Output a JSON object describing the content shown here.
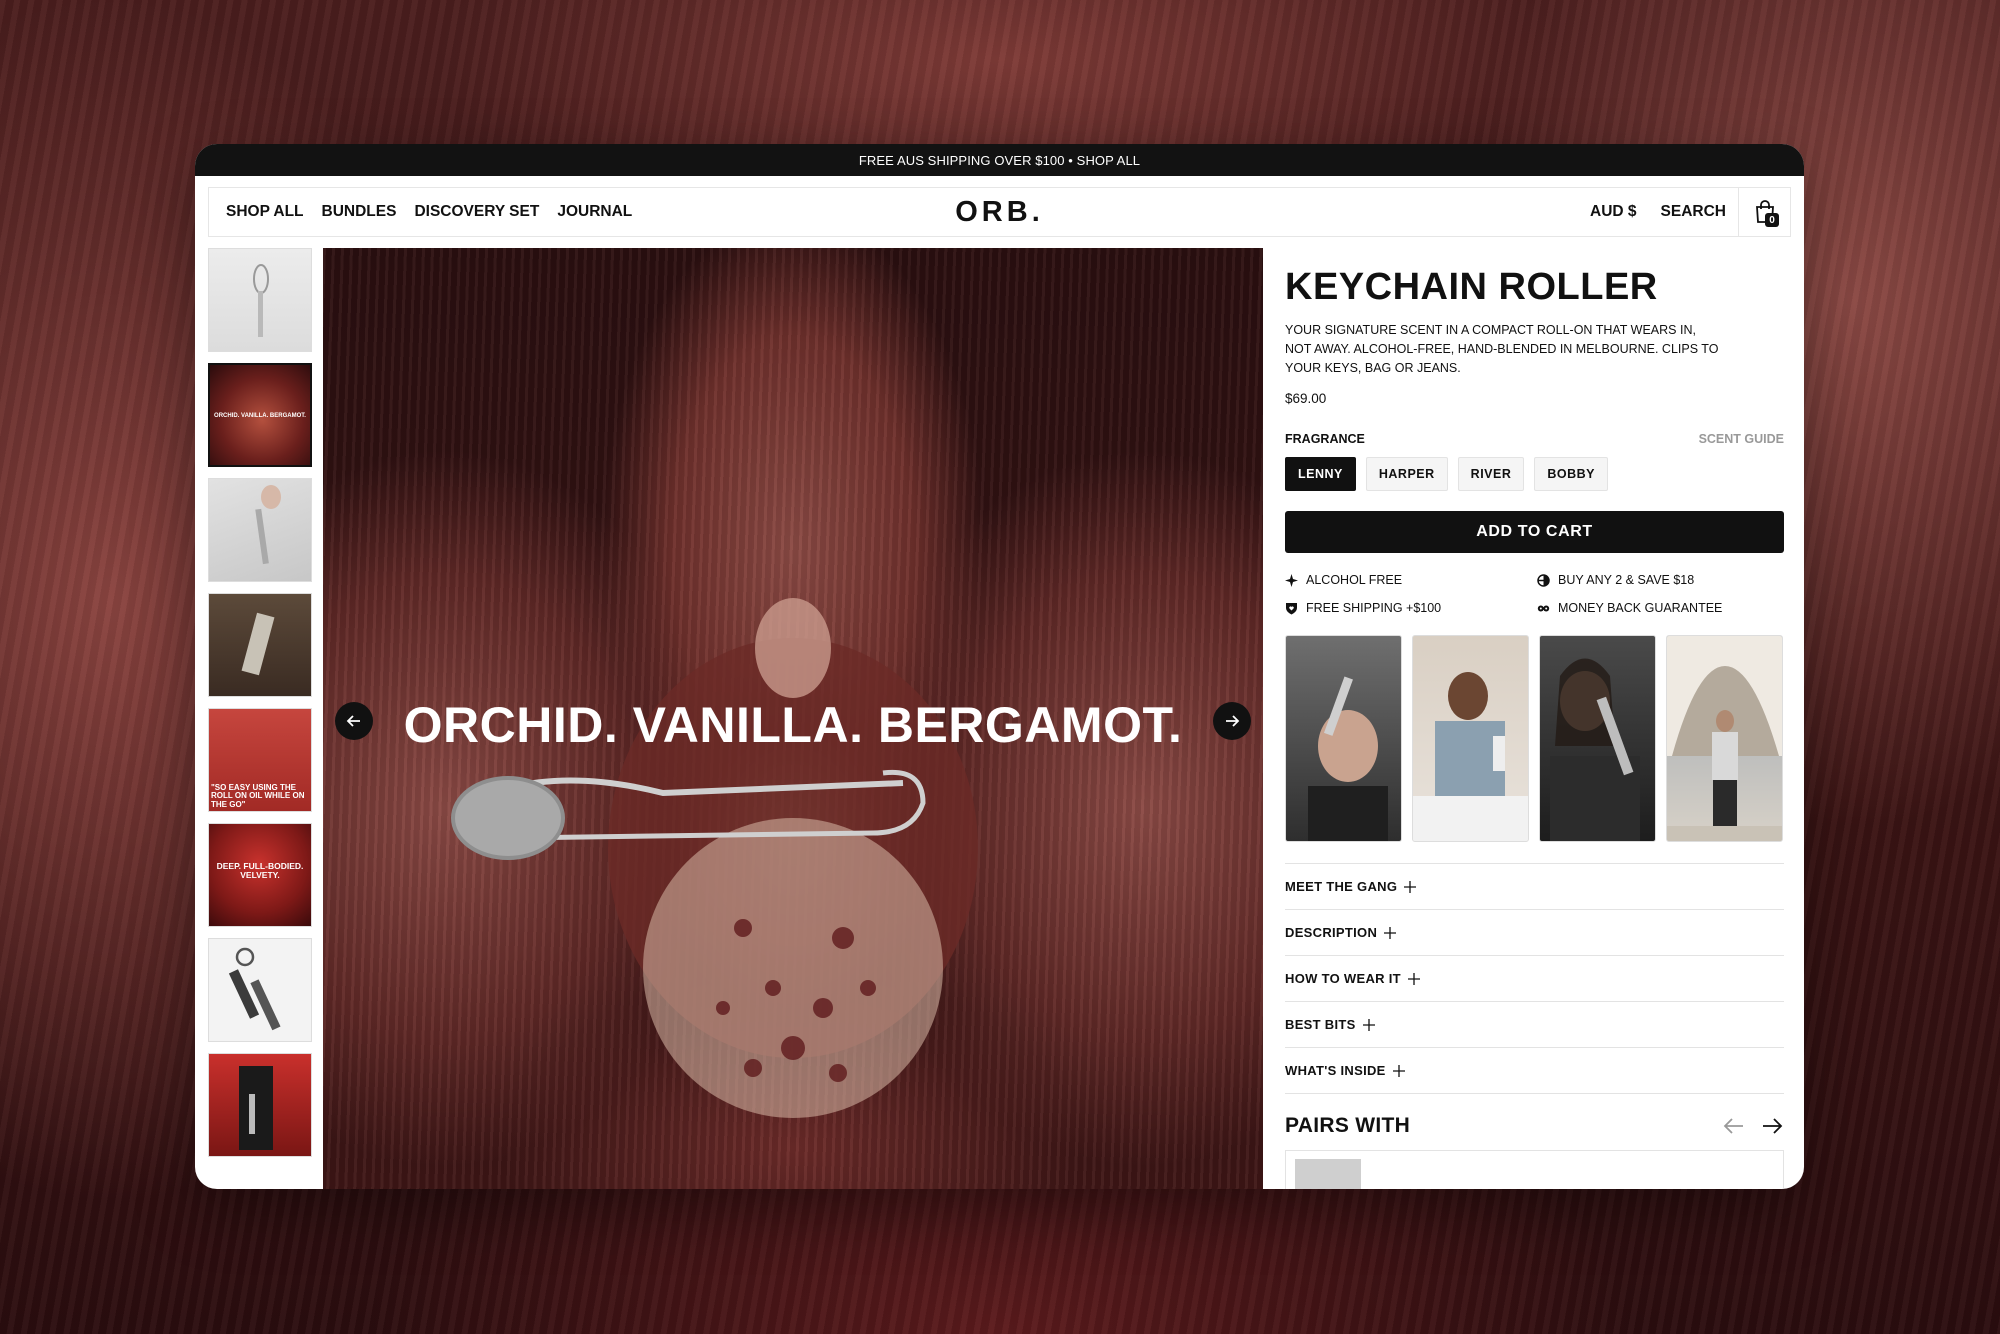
{
  "announcement": "FREE AUS SHIPPING OVER $100 • SHOP ALL",
  "nav": {
    "links": [
      "SHOP ALL",
      "BUNDLES",
      "DISCOVERY SET",
      "JOURNAL"
    ],
    "logo": "ORB.",
    "currency": "AUD $",
    "search": "SEARCH",
    "cart_count": "0"
  },
  "thumbnails": [
    {
      "caption": ""
    },
    {
      "caption": "ORCHID. VANILLA. BERGAMOT."
    },
    {
      "caption": ""
    },
    {
      "caption": ""
    },
    {
      "caption": "\"SO EASY USING THE ROLL ON OIL WHILE ON THE GO\""
    },
    {
      "caption": "DEEP. FULL-BODIED. VELVETY."
    },
    {
      "caption": ""
    },
    {
      "caption": ""
    }
  ],
  "hero": {
    "title": "ORCHID. VANILLA. BERGAMOT."
  },
  "product": {
    "title": "KEYCHAIN ROLLER",
    "description": "YOUR SIGNATURE SCENT IN A COMPACT ROLL-ON THAT WEARS IN, NOT AWAY. ALCOHOL-FREE, HAND-BLENDED IN MELBOURNE. CLIPS TO YOUR KEYS, BAG OR JEANS.",
    "price": "$69.00",
    "fragrance_label": "FRAGRANCE",
    "scent_guide": "SCENT GUIDE",
    "fragrances": [
      "LENNY",
      "HARPER",
      "RIVER",
      "BOBBY"
    ],
    "selected_fragrance": "LENNY",
    "add_to_cart": "ADD TO CART",
    "features": [
      {
        "icon": "sparkle-icon",
        "label": "ALCOHOL FREE"
      },
      {
        "icon": "half-circle-icon",
        "label": "BUY ANY 2 & SAVE $18"
      },
      {
        "icon": "heart-shield-icon",
        "label": "FREE SHIPPING +$100"
      },
      {
        "icon": "infinity-icon",
        "label": "MONEY BACK GUARANTEE"
      }
    ],
    "accordion": [
      "MEET THE GANG",
      "DESCRIPTION",
      "HOW TO WEAR IT",
      "BEST BITS",
      "WHAT'S INSIDE"
    ],
    "pairs_with": "PAIRS WITH"
  },
  "colors": {
    "accent": "#111111",
    "announcement_bg": "#121212",
    "muted": "#999999"
  }
}
